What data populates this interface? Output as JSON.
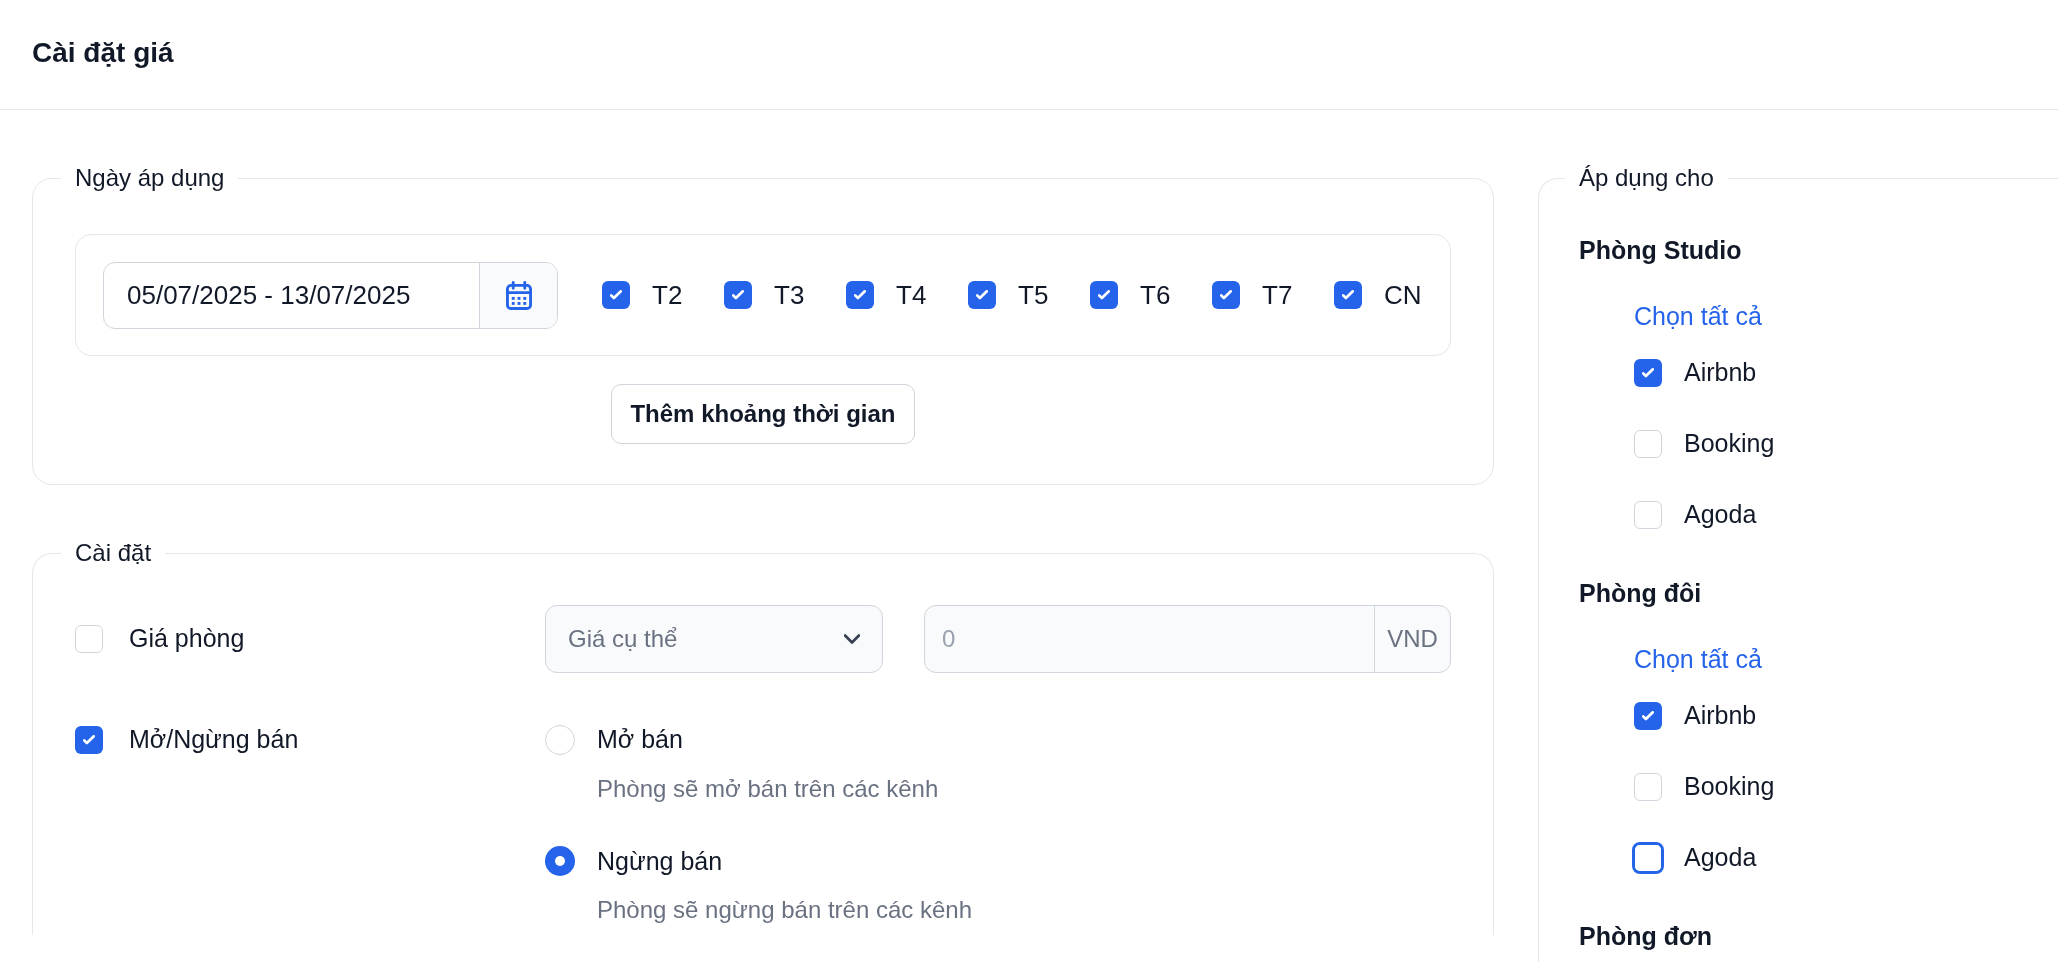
{
  "page": {
    "title": "Cài đặt giá"
  },
  "date_section": {
    "legend": "Ngày áp dụng",
    "ranges": [
      {
        "value": "05/07/2025 - 13/07/2025",
        "weekdays": [
          {
            "label": "T2",
            "checked": true
          },
          {
            "label": "T3",
            "checked": true
          },
          {
            "label": "T4",
            "checked": true
          },
          {
            "label": "T5",
            "checked": true
          },
          {
            "label": "T6",
            "checked": true
          },
          {
            "label": "T7",
            "checked": true
          },
          {
            "label": "CN",
            "checked": true
          }
        ]
      }
    ],
    "add_button": "Thêm khoảng thời gian"
  },
  "settings_section": {
    "legend": "Cài đặt",
    "price": {
      "label": "Giá phòng",
      "checked": false,
      "select_value": "Giá cụ thể",
      "amount": "0",
      "unit": "VND"
    },
    "sale": {
      "label": "Mở/Ngừng bán",
      "checked": true,
      "options": [
        {
          "label": "Mở bán",
          "description": "Phòng sẽ mở bán trên các kênh",
          "selected": false
        },
        {
          "label": "Ngừng bán",
          "description": "Phòng sẽ ngừng bán trên các kênh",
          "selected": true
        }
      ]
    }
  },
  "apply_section": {
    "legend": "Áp dụng cho",
    "groups": [
      {
        "name": "Phòng Studio",
        "select_all": "Chọn tất cả",
        "channels": [
          {
            "label": "Airbnb",
            "checked": true,
            "focused": false
          },
          {
            "label": "Booking",
            "checked": false,
            "focused": false
          },
          {
            "label": "Agoda",
            "checked": false,
            "focused": false
          }
        ]
      },
      {
        "name": "Phòng đôi",
        "select_all": "Chọn tất cả",
        "channels": [
          {
            "label": "Airbnb",
            "checked": true,
            "focused": false
          },
          {
            "label": "Booking",
            "checked": false,
            "focused": false
          },
          {
            "label": "Agoda",
            "checked": false,
            "focused": true
          }
        ]
      },
      {
        "name": "Phòng đơn"
      }
    ]
  }
}
